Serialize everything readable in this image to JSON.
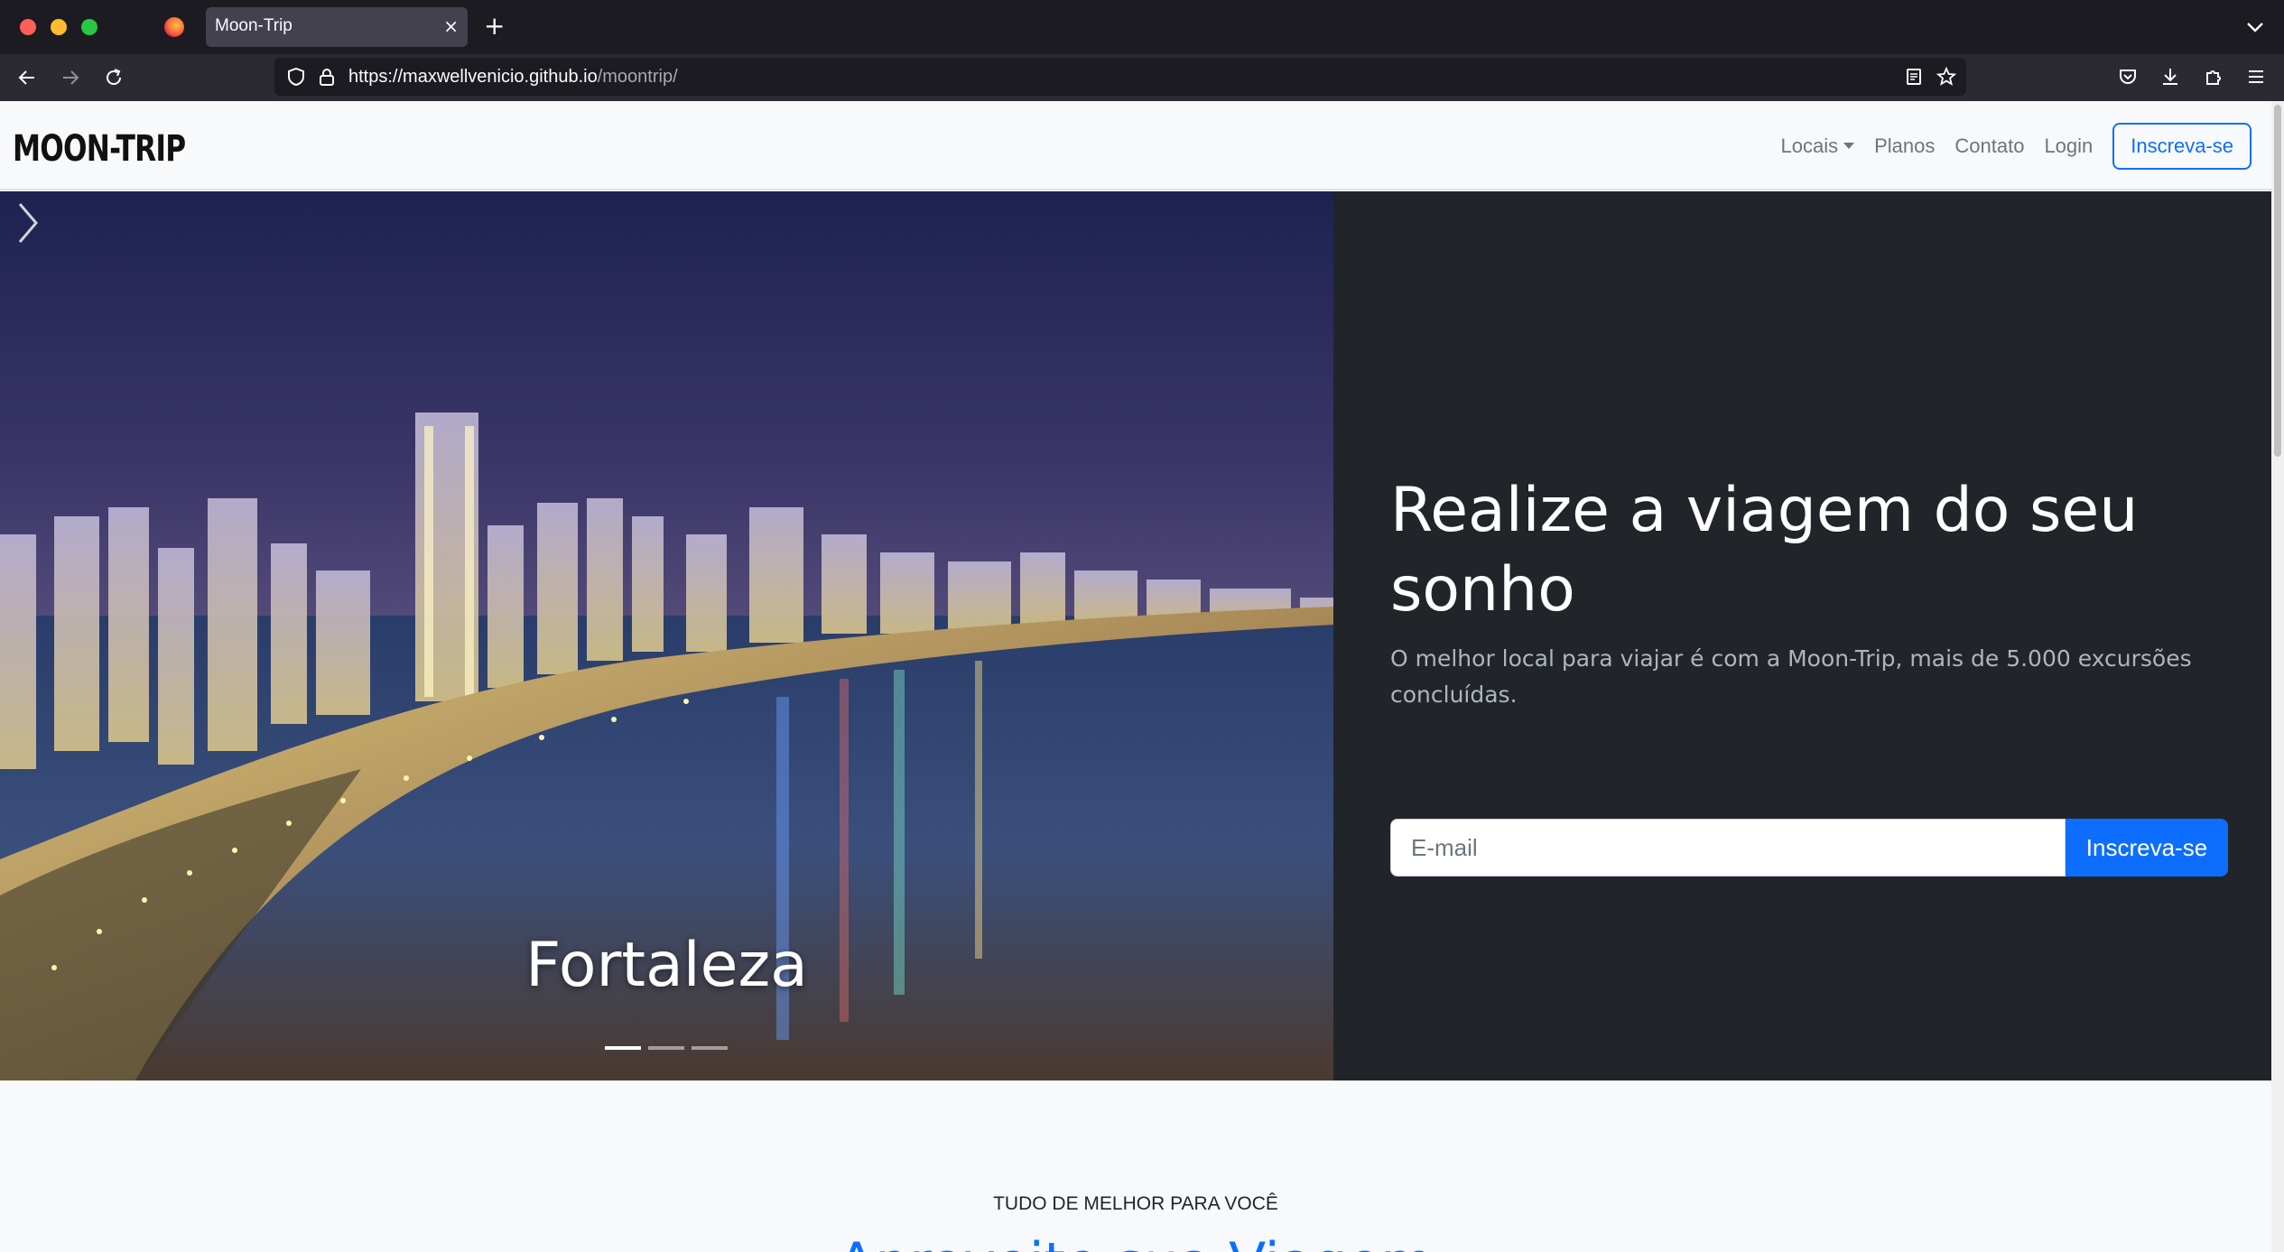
{
  "browser": {
    "tab_title": "Moon-Trip",
    "tab_close": "×",
    "new_tab": "+",
    "url_host": "https://maxwellvenicio.github.io",
    "url_path": "/moontrip/"
  },
  "site": {
    "brand": "MOON-TRIP",
    "nav": {
      "locais": "Locais",
      "planos": "Planos",
      "contato": "Contato",
      "login": "Login",
      "signup": "Inscreva-se"
    }
  },
  "hero": {
    "carousel_caption": "Fortaleza",
    "slides": 3,
    "active_slide": 1,
    "title": "Realize a viagem do seu sonho",
    "subtitle": "O melhor local para viajar é com a Moon-Trip, mais de 5.000 excursões concluídas.",
    "email_placeholder": "E-mail",
    "signup_button": "Inscreva-se"
  },
  "section": {
    "eyebrow": "TUDO DE MELHOR PARA VOCÊ",
    "title": "Aproveite sua Viagem"
  },
  "colors": {
    "accent": "#0d6efd",
    "hero_bg": "#212529",
    "page_bg": "#f8f9fa"
  }
}
